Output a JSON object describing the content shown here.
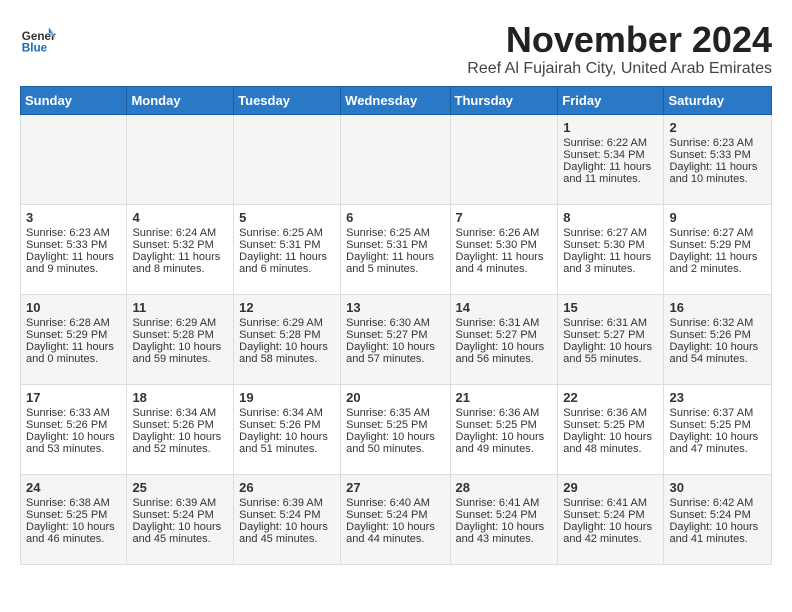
{
  "header": {
    "logo_general": "General",
    "logo_blue": "Blue",
    "month_title": "November 2024",
    "subtitle": "Reef Al Fujairah City, United Arab Emirates"
  },
  "weekdays": [
    "Sunday",
    "Monday",
    "Tuesday",
    "Wednesday",
    "Thursday",
    "Friday",
    "Saturday"
  ],
  "weeks": [
    [
      {
        "day": "",
        "content": ""
      },
      {
        "day": "",
        "content": ""
      },
      {
        "day": "",
        "content": ""
      },
      {
        "day": "",
        "content": ""
      },
      {
        "day": "",
        "content": ""
      },
      {
        "day": "1",
        "content": "Sunrise: 6:22 AM\nSunset: 5:34 PM\nDaylight: 11 hours and 11 minutes."
      },
      {
        "day": "2",
        "content": "Sunrise: 6:23 AM\nSunset: 5:33 PM\nDaylight: 11 hours and 10 minutes."
      }
    ],
    [
      {
        "day": "3",
        "content": "Sunrise: 6:23 AM\nSunset: 5:33 PM\nDaylight: 11 hours and 9 minutes."
      },
      {
        "day": "4",
        "content": "Sunrise: 6:24 AM\nSunset: 5:32 PM\nDaylight: 11 hours and 8 minutes."
      },
      {
        "day": "5",
        "content": "Sunrise: 6:25 AM\nSunset: 5:31 PM\nDaylight: 11 hours and 6 minutes."
      },
      {
        "day": "6",
        "content": "Sunrise: 6:25 AM\nSunset: 5:31 PM\nDaylight: 11 hours and 5 minutes."
      },
      {
        "day": "7",
        "content": "Sunrise: 6:26 AM\nSunset: 5:30 PM\nDaylight: 11 hours and 4 minutes."
      },
      {
        "day": "8",
        "content": "Sunrise: 6:27 AM\nSunset: 5:30 PM\nDaylight: 11 hours and 3 minutes."
      },
      {
        "day": "9",
        "content": "Sunrise: 6:27 AM\nSunset: 5:29 PM\nDaylight: 11 hours and 2 minutes."
      }
    ],
    [
      {
        "day": "10",
        "content": "Sunrise: 6:28 AM\nSunset: 5:29 PM\nDaylight: 11 hours and 0 minutes."
      },
      {
        "day": "11",
        "content": "Sunrise: 6:29 AM\nSunset: 5:28 PM\nDaylight: 10 hours and 59 minutes."
      },
      {
        "day": "12",
        "content": "Sunrise: 6:29 AM\nSunset: 5:28 PM\nDaylight: 10 hours and 58 minutes."
      },
      {
        "day": "13",
        "content": "Sunrise: 6:30 AM\nSunset: 5:27 PM\nDaylight: 10 hours and 57 minutes."
      },
      {
        "day": "14",
        "content": "Sunrise: 6:31 AM\nSunset: 5:27 PM\nDaylight: 10 hours and 56 minutes."
      },
      {
        "day": "15",
        "content": "Sunrise: 6:31 AM\nSunset: 5:27 PM\nDaylight: 10 hours and 55 minutes."
      },
      {
        "day": "16",
        "content": "Sunrise: 6:32 AM\nSunset: 5:26 PM\nDaylight: 10 hours and 54 minutes."
      }
    ],
    [
      {
        "day": "17",
        "content": "Sunrise: 6:33 AM\nSunset: 5:26 PM\nDaylight: 10 hours and 53 minutes."
      },
      {
        "day": "18",
        "content": "Sunrise: 6:34 AM\nSunset: 5:26 PM\nDaylight: 10 hours and 52 minutes."
      },
      {
        "day": "19",
        "content": "Sunrise: 6:34 AM\nSunset: 5:26 PM\nDaylight: 10 hours and 51 minutes."
      },
      {
        "day": "20",
        "content": "Sunrise: 6:35 AM\nSunset: 5:25 PM\nDaylight: 10 hours and 50 minutes."
      },
      {
        "day": "21",
        "content": "Sunrise: 6:36 AM\nSunset: 5:25 PM\nDaylight: 10 hours and 49 minutes."
      },
      {
        "day": "22",
        "content": "Sunrise: 6:36 AM\nSunset: 5:25 PM\nDaylight: 10 hours and 48 minutes."
      },
      {
        "day": "23",
        "content": "Sunrise: 6:37 AM\nSunset: 5:25 PM\nDaylight: 10 hours and 47 minutes."
      }
    ],
    [
      {
        "day": "24",
        "content": "Sunrise: 6:38 AM\nSunset: 5:25 PM\nDaylight: 10 hours and 46 minutes."
      },
      {
        "day": "25",
        "content": "Sunrise: 6:39 AM\nSunset: 5:24 PM\nDaylight: 10 hours and 45 minutes."
      },
      {
        "day": "26",
        "content": "Sunrise: 6:39 AM\nSunset: 5:24 PM\nDaylight: 10 hours and 45 minutes."
      },
      {
        "day": "27",
        "content": "Sunrise: 6:40 AM\nSunset: 5:24 PM\nDaylight: 10 hours and 44 minutes."
      },
      {
        "day": "28",
        "content": "Sunrise: 6:41 AM\nSunset: 5:24 PM\nDaylight: 10 hours and 43 minutes."
      },
      {
        "day": "29",
        "content": "Sunrise: 6:41 AM\nSunset: 5:24 PM\nDaylight: 10 hours and 42 minutes."
      },
      {
        "day": "30",
        "content": "Sunrise: 6:42 AM\nSunset: 5:24 PM\nDaylight: 10 hours and 41 minutes."
      }
    ]
  ]
}
